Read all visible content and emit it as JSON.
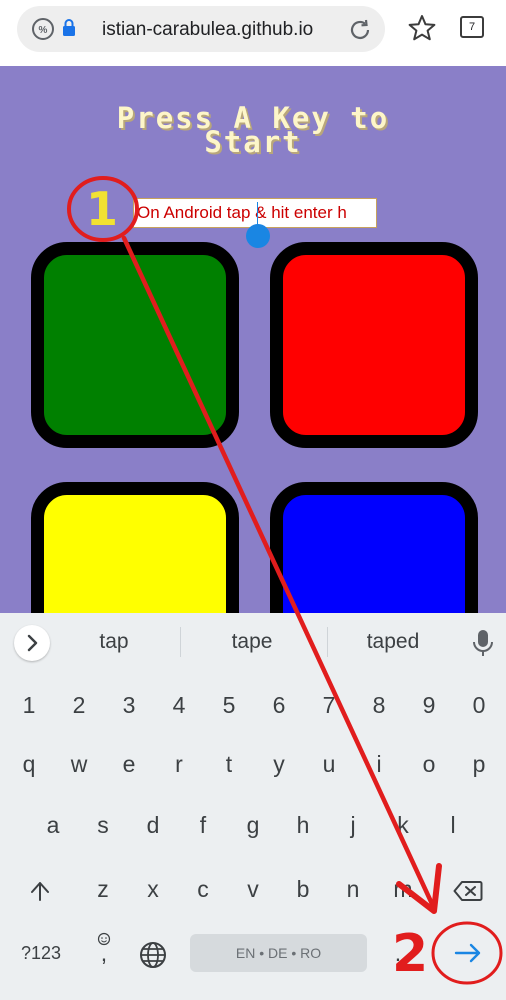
{
  "browser": {
    "url": "istian-carabulea.github.io",
    "tab_count": "7"
  },
  "game": {
    "title_line1": "Press A Key to",
    "title_line2": "Start",
    "input_value": "On Android tap & hit enter h",
    "pads": [
      {
        "color": "#008000"
      },
      {
        "color": "#ff0000"
      },
      {
        "color": "#ffff00"
      },
      {
        "color": "#0000ff"
      }
    ]
  },
  "keyboard": {
    "suggestions": [
      "tap",
      "tape",
      "taped"
    ],
    "number_row": [
      "1",
      "2",
      "3",
      "4",
      "5",
      "6",
      "7",
      "8",
      "9",
      "0"
    ],
    "row1": [
      "q",
      "w",
      "e",
      "r",
      "t",
      "y",
      "u",
      "i",
      "o",
      "p"
    ],
    "row2": [
      "a",
      "s",
      "d",
      "f",
      "g",
      "h",
      "j",
      "k",
      "l"
    ],
    "row3": [
      "z",
      "x",
      "c",
      "v",
      "b",
      "n",
      "m"
    ],
    "symbols_key": "?123",
    "comma_key": ",",
    "period_key": ".",
    "space_label": "EN • DE • RO"
  },
  "annotations": {
    "step1": "1",
    "step2": "2",
    "color": "#e11d1d"
  }
}
